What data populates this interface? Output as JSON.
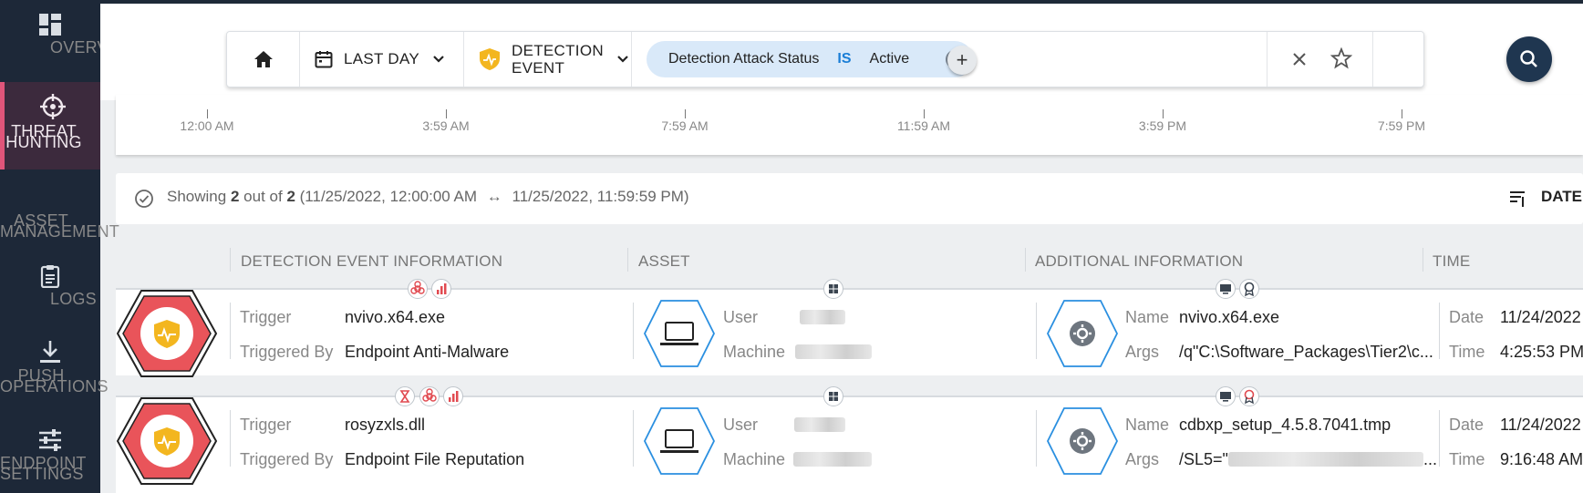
{
  "sidebar": {
    "items": [
      {
        "label": "OVERVIEW",
        "icon": "dashboard-icon"
      },
      {
        "label": "THREAT HUNTING",
        "icon": "crosshair-icon",
        "active": true
      },
      {
        "label": "ASSET MANAGEMENT",
        "icon": "asset-icon"
      },
      {
        "label": "LOGS",
        "icon": "clipboard-icon"
      },
      {
        "label": "PUSH OPERATIONS",
        "icon": "download-icon"
      },
      {
        "label": "ENDPOINT SETTINGS",
        "icon": "sliders-icon"
      }
    ]
  },
  "filterbar": {
    "home_icon": "home-icon",
    "date_range": "LAST DAY",
    "event_type_line1": "DETECTION",
    "event_type_line2": "EVENT",
    "chip": {
      "field": "Detection Attack Status",
      "operator": "IS",
      "value": "Active"
    },
    "add_label": "+"
  },
  "timeline": {
    "ticks": [
      "12:00 AM",
      "3:59 AM",
      "7:59 AM",
      "11:59 AM",
      "3:59 PM",
      "7:59 PM"
    ]
  },
  "summary": {
    "prefix": "Showing",
    "count": "2",
    "mid": "out of",
    "total": "2",
    "range_start": "(11/25/2022, 12:00:00 AM",
    "arrow": "↔",
    "range_end": "11/25/2022, 11:59:59 PM)",
    "sort_label": "DATE"
  },
  "columns": {
    "detection": "DETECTION EVENT INFORMATION",
    "asset": "ASSET",
    "additional": "ADDITIONAL INFORMATION",
    "time": "TIME"
  },
  "labels": {
    "trigger": "Trigger",
    "triggered_by": "Triggered By",
    "user": "User",
    "machine": "Machine",
    "name": "Name",
    "args": "Args",
    "date": "Date",
    "time": "Time"
  },
  "rows": [
    {
      "trigger": "nvivo.x64.exe",
      "triggered_by": "Endpoint Anti-Malware",
      "name": "nvivo.x64.exe",
      "args": "/q\"C:\\Software_Packages\\Tier2\\c...",
      "date": "11/24/2022",
      "time": "4:25:53 PM"
    },
    {
      "trigger": "rosyzxls.dll",
      "triggered_by": "Endpoint File Reputation",
      "name": "cdbxp_setup_4.5.8.7041.tmp",
      "args_prefix": "/SL5=\"",
      "args_suffix": "...",
      "date": "11/24/2022",
      "time": "9:16:48 AM"
    }
  ],
  "colors": {
    "sidebar_bg": "#1d2838",
    "active_accent": "#e1557a",
    "threat_red": "#e9545a",
    "shield_yellow": "#f3b61f",
    "asset_blue": "#2a8fe0",
    "search_btn": "#1f3650"
  }
}
